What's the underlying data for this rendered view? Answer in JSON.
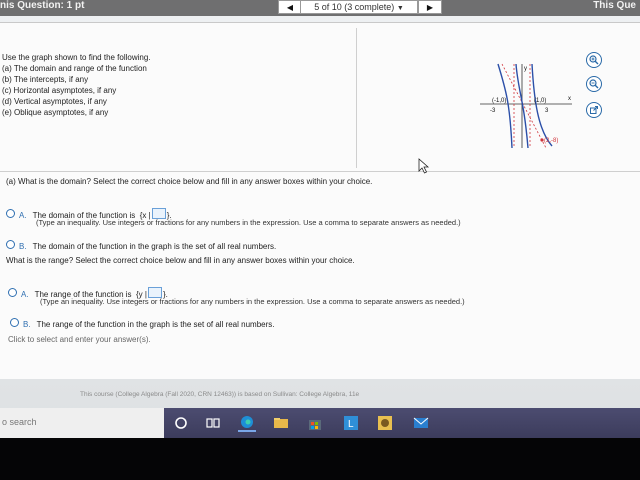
{
  "header": {
    "question_label": "nis Question: 1 pt",
    "progress": "5 of 10 (3 complete)",
    "right_label": "This Que"
  },
  "instructions": {
    "lines": [
      "Use the graph shown to find the following.",
      "(a) The domain and range of the function",
      "(b) The intercepts, if any",
      "(c) Horizontal asymptotes, if any",
      "(d) Vertical asymptotes, if any",
      "(e) Oblique asymptotes, if any"
    ]
  },
  "graph": {
    "labels": {
      "point_left": "(-1,0)",
      "point_right": "(1,0)",
      "point_low": "(2,-8)",
      "tick_neg3": "-3",
      "tick_pos3": "3",
      "axis_x": "x",
      "axis_y": "y"
    }
  },
  "part_a": {
    "question": "(a) What is the domain? Select the correct choice below and fill in any answer boxes within your choice.",
    "option_a_letter": "A.",
    "option_a_text": "The domain of the function is",
    "option_a_set": "{x |",
    "option_a_close": "}.",
    "option_a_hint": "(Type an inequality. Use integers or fractions for any numbers in the expression. Use a comma to separate answers as needed.)",
    "option_b_letter": "B.",
    "option_b_text": "The domain of the function in the graph is the set of all real numbers."
  },
  "range": {
    "question": "What is the range? Select the correct choice below and fill in any answer boxes within your choice.",
    "option_a_letter": "A.",
    "option_a_text": "The range of the function is",
    "option_a_set": "{y |",
    "option_a_close": "}.",
    "option_a_hint": "(Type an inequality. Use integers or fractions for any numbers in the expression. Use a comma to separate answers as needed.)",
    "option_b_letter": "B.",
    "option_b_text": "The range of the function in the graph is the set of all real numbers."
  },
  "footer": {
    "note": "Click to select and enter your answer(s).",
    "course_info": "This course (College Algebra (Fall 2020, CRN 12463)) is based on Sullivan: College Algebra, 11e"
  },
  "taskbar": {
    "search_text": "o search"
  },
  "colors": {
    "accent": "#2f6fb1",
    "taskbar": "#44446a",
    "curve": "#2b4fa8",
    "asymptote": "#d0343a"
  }
}
